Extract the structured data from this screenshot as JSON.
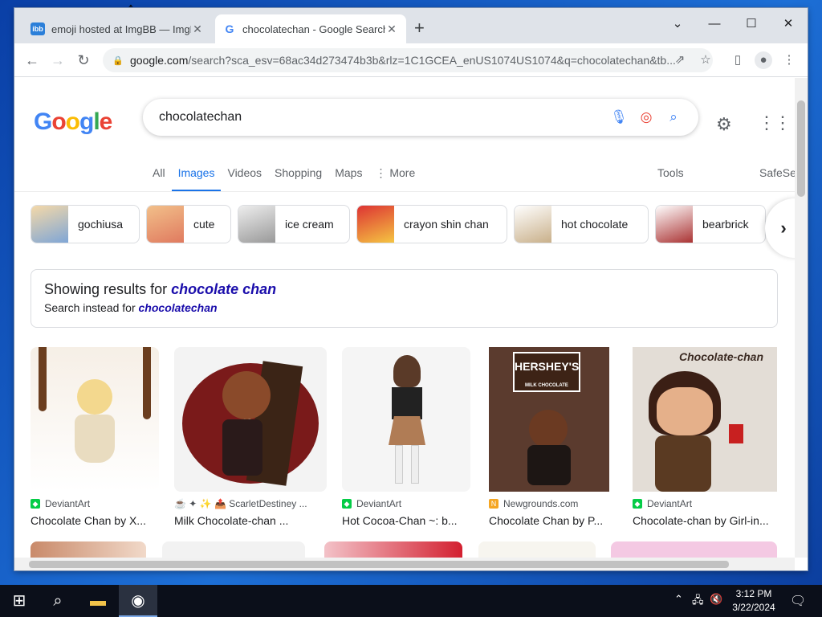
{
  "browser": {
    "tabs": [
      {
        "label": "emoji hosted at ImgBB — ImgBB",
        "favicon": "ibb"
      },
      {
        "label": "chocolatechan - Google Search",
        "favicon": "G"
      }
    ],
    "new_tab": "+",
    "window_controls": {
      "list": "⌄",
      "minimize": "—",
      "maximize": "☐",
      "close": "✕"
    },
    "url_host": "google.com",
    "url_path": "/search?sca_esv=68ac34d273474b3b&rlz=1C1GCEA_enUS1074US1074&q=chocolatechan&tb..."
  },
  "search": {
    "logo": [
      "G",
      "o",
      "o",
      "g",
      "l",
      "e"
    ],
    "logo_colors": [
      "#4285f4",
      "#ea4335",
      "#fbbc05",
      "#4285f4",
      "#34a853",
      "#ea4335"
    ],
    "query": "chocolatechan"
  },
  "nav": {
    "tabs": [
      "All",
      "Images",
      "Videos",
      "Shopping",
      "Maps",
      "⋮ More"
    ],
    "tools": "Tools",
    "safesearch": "SafeSe"
  },
  "chips": [
    "gochiusa",
    "cute",
    "ice cream",
    "crayon shin chan",
    "hot chocolate",
    "bearbrick"
  ],
  "notice": {
    "showing_prefix": "Showing results for ",
    "showing_term": "chocolate chan",
    "instead_prefix": "Search instead for ",
    "instead_term": "chocolatechan"
  },
  "results": [
    {
      "source": "DeviantArt",
      "title": "Chocolate Chan by X..."
    },
    {
      "source": "☕ ✦ ✨ 📤 ScarletDestiney ...",
      "title": "Milk Chocolate-chan ..."
    },
    {
      "source": "DeviantArt",
      "title": "Hot Cocoa-Chan ~: b..."
    },
    {
      "source": "Newgrounds.com",
      "title": "Chocolate Chan by P..."
    },
    {
      "source": "DeviantArt",
      "title": "Chocolate-chan by Girl-in..."
    }
  ],
  "result_image_text": {
    "hersheys": "HERSHEY'S",
    "milk_choc": "MILK CHOCOLATE",
    "chocolate_chan": "Chocolate-chan"
  },
  "taskbar": {
    "time": "3:12 PM",
    "date": "3/22/2024"
  }
}
